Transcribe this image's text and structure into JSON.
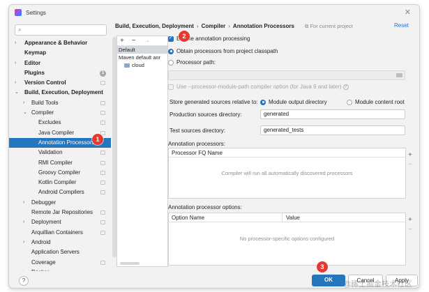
{
  "window": {
    "title": "Settings"
  },
  "search": {
    "value": "",
    "placeholder": ""
  },
  "sidebar": {
    "items": [
      {
        "label": "Appearance & Behavior",
        "level": 0,
        "bold": true,
        "chevron": "›"
      },
      {
        "label": "Keymap",
        "level": 0,
        "bold": true,
        "chevron": ""
      },
      {
        "label": "Editor",
        "level": 0,
        "bold": true,
        "chevron": "›"
      },
      {
        "label": "Plugins",
        "level": 0,
        "bold": true,
        "chevron": "",
        "info": "1"
      },
      {
        "label": "Version Control",
        "level": 0,
        "bold": true,
        "chevron": "›",
        "mark": true
      },
      {
        "label": "Build, Execution, Deployment",
        "level": 0,
        "bold": true,
        "chevron": "⌄"
      },
      {
        "label": "Build Tools",
        "level": 1,
        "chevron": "›",
        "mark": true
      },
      {
        "label": "Compiler",
        "level": 1,
        "chevron": "⌄",
        "mark": true
      },
      {
        "label": "Excludes",
        "level": 2,
        "chevron": "",
        "mark": true
      },
      {
        "label": "Java Compiler",
        "level": 2,
        "chevron": "",
        "mark": true
      },
      {
        "label": "Annotation Processors",
        "level": 2,
        "chevron": "",
        "selected": true
      },
      {
        "label": "Validation",
        "level": 2,
        "chevron": "",
        "mark": true
      },
      {
        "label": "RMI Compiler",
        "level": 2,
        "chevron": "",
        "mark": true
      },
      {
        "label": "Groovy Compiler",
        "level": 2,
        "chevron": "",
        "mark": true
      },
      {
        "label": "Kotlin Compiler",
        "level": 2,
        "chevron": "",
        "mark": true
      },
      {
        "label": "Android Compilers",
        "level": 2,
        "chevron": "",
        "mark": true
      },
      {
        "label": "Debugger",
        "level": 1,
        "chevron": "›"
      },
      {
        "label": "Remote Jar Repositories",
        "level": 1,
        "chevron": "",
        "mark": true
      },
      {
        "label": "Deployment",
        "level": 1,
        "chevron": "›",
        "mark": true
      },
      {
        "label": "Arquillian Containers",
        "level": 1,
        "chevron": "",
        "mark": true
      },
      {
        "label": "Android",
        "level": 1,
        "chevron": "›"
      },
      {
        "label": "Application Servers",
        "level": 1,
        "chevron": ""
      },
      {
        "label": "Coverage",
        "level": 1,
        "chevron": "",
        "mark": true
      },
      {
        "label": "Docker",
        "level": 1,
        "chevron": "›"
      }
    ]
  },
  "breadcrumb": {
    "part1": "Build, Execution, Deployment",
    "part2": "Compiler",
    "part3": "Annotation Processors",
    "separator": "›"
  },
  "header": {
    "for_project": "For current project",
    "reset": "Reset"
  },
  "profiles": {
    "toolbar": {
      "add": "+",
      "remove": "−",
      "move": "→"
    },
    "rows": [
      "Default",
      "Maven default anr",
      "cloud"
    ]
  },
  "options": {
    "enable_processing": "Enable annotation processing",
    "from_classpath": "Obtain processors from project classpath",
    "processor_path": "Processor path:",
    "processor_path_value": "",
    "module_path_option": "Use --processor-module-path compiler option (for Java 9 and later)",
    "store_label": "Store generated sources relative to:",
    "store_module_output": "Module output directory",
    "store_content_root": "Module content root"
  },
  "fields": {
    "production_label": "Production sources directory:",
    "production_value": "generated",
    "test_label": "Test sources directory:",
    "test_value": "generated_tests"
  },
  "processors": {
    "label": "Annotation processors:",
    "column": "Processor FQ Name",
    "empty": "Compiler will run all automatically discovered processors"
  },
  "processor_options": {
    "label": "Annotation processor options:",
    "col_name": "Option Name",
    "col_value": "Value",
    "empty": "No processor-specific options configured"
  },
  "tools": {
    "plus": "+",
    "minus": "−"
  },
  "buttons": {
    "ok": "OK",
    "cancel": "Cancel",
    "apply": "Apply",
    "help": "?"
  },
  "badges": [
    "1",
    "2",
    "3"
  ],
  "watermark": "@稀土掘金技术社区",
  "colors": {
    "accent": "#2675bf",
    "badge": "#e8382f",
    "link": "#2f6fd3"
  }
}
